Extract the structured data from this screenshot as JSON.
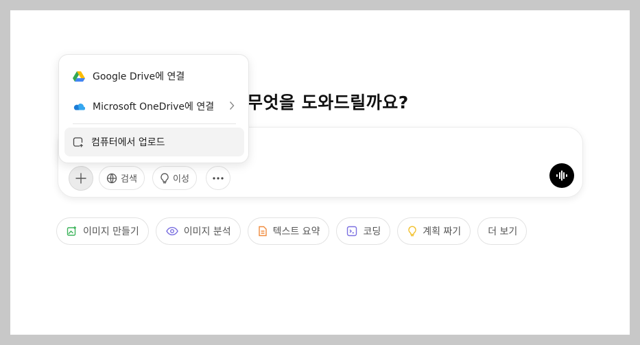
{
  "heading": "무엇을 도와드릴까요?",
  "toolbar": {
    "search_label": "검색",
    "reasoning_label": "이성"
  },
  "menu": {
    "items": [
      {
        "label": "Google Drive에 연결",
        "icon": "google-drive-icon"
      },
      {
        "label": "Microsoft OneDrive에 연결",
        "icon": "onedrive-icon"
      },
      {
        "label": "컴퓨터에서 업로드",
        "icon": "upload-file-icon"
      }
    ]
  },
  "chips": [
    {
      "label": "이미지 만들기",
      "icon": "image-create-icon",
      "color": "#3cb35a"
    },
    {
      "label": "이미지 분석",
      "icon": "eye-icon",
      "color": "#7a6fe0"
    },
    {
      "label": "텍스트 요약",
      "icon": "document-icon",
      "color": "#f08a3c"
    },
    {
      "label": "코딩",
      "icon": "terminal-icon",
      "color": "#7a6fe0"
    },
    {
      "label": "계획 짜기",
      "icon": "lightbulb-icon",
      "color": "#f2c12e"
    },
    {
      "label": "더 보기",
      "icon": "",
      "color": ""
    }
  ]
}
